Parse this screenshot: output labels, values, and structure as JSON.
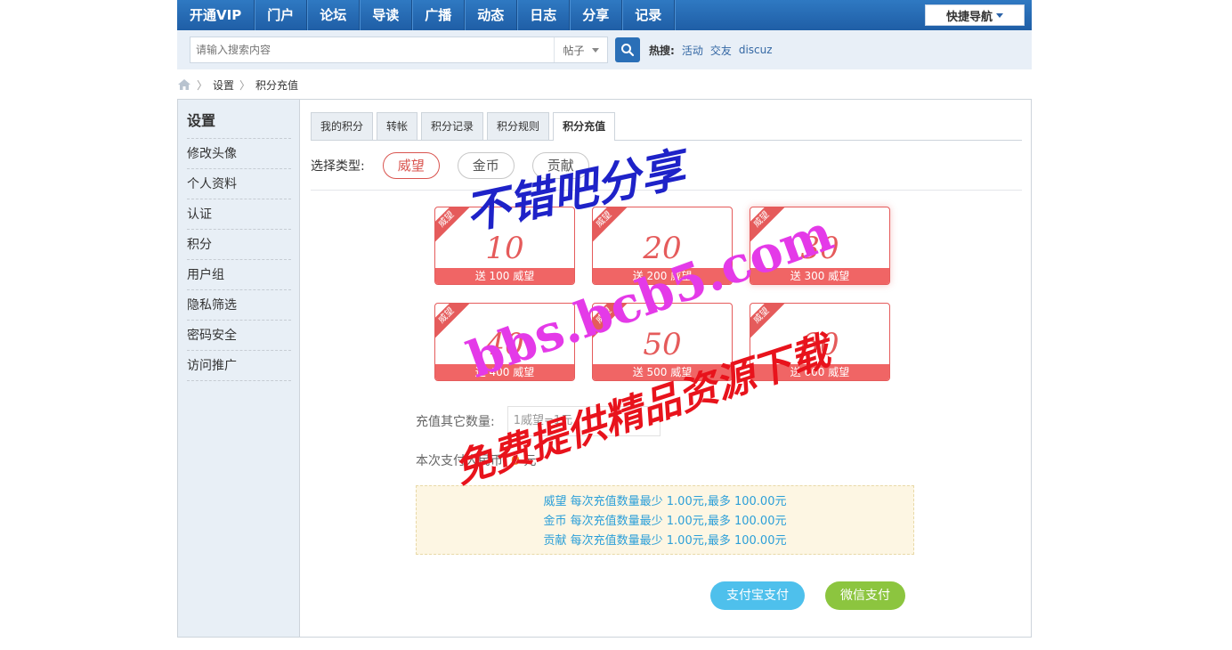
{
  "topnav": {
    "items": [
      "开通VIP",
      "门户",
      "论坛",
      "导读",
      "广播",
      "动态",
      "日志",
      "分享",
      "记录"
    ],
    "quick_nav": "快捷导航"
  },
  "search": {
    "placeholder": "请输入搜索内容",
    "type": "帖子",
    "hot_label": "热搜:",
    "hot_items": [
      "活动",
      "交友",
      "discuz"
    ]
  },
  "breadcrumb": {
    "items": [
      "设置",
      "积分充值"
    ]
  },
  "sidebar": {
    "title": "设置",
    "items": [
      "修改头像",
      "个人资料",
      "认证",
      "积分",
      "用户组",
      "隐私筛选",
      "密码安全",
      "访问推广"
    ]
  },
  "tabs": [
    "我的积分",
    "转帐",
    "积分记录",
    "积分规则",
    "积分充值"
  ],
  "type_select": {
    "label": "选择类型:",
    "options": [
      "威望",
      "金币",
      "贡献"
    ]
  },
  "cards": [
    {
      "tag": "威望",
      "amount": "10",
      "bonus": "送 100 威望"
    },
    {
      "tag": "威望",
      "amount": "20",
      "bonus": "送 200 威望"
    },
    {
      "tag": "威望",
      "amount": "30",
      "bonus": "送 300 威望"
    },
    {
      "tag": "威望",
      "amount": "40",
      "bonus": "送 400 威望"
    },
    {
      "tag": "威望",
      "amount": "50",
      "bonus": "送 500 威望"
    },
    {
      "tag": "威望",
      "amount": "60",
      "bonus": "送 600 威望"
    }
  ],
  "other": {
    "label": "充值其它数量:",
    "placeholder": "1威望=1元"
  },
  "paynow": {
    "prefix": "本次支付人民币:",
    "value": "0",
    "unit": "元"
  },
  "notice": [
    "威望 每次充值数量最少 1.00元,最多 100.00元",
    "金币 每次充值数量最少 1.00元,最多 100.00元",
    "贡献 每次充值数量最少 1.00元,最多 100.00元"
  ],
  "buttons": {
    "alipay": "支付宝支付",
    "wechat": "微信支付"
  },
  "watermark": [
    "不错吧分享",
    "bbs.bcb5.com",
    "免费提供精品资源下载"
  ],
  "colors": {
    "nav": "#2a6fb7",
    "accent": "#e55b5b",
    "alipay": "#4ec0ec",
    "wechat": "#8cc53f"
  }
}
